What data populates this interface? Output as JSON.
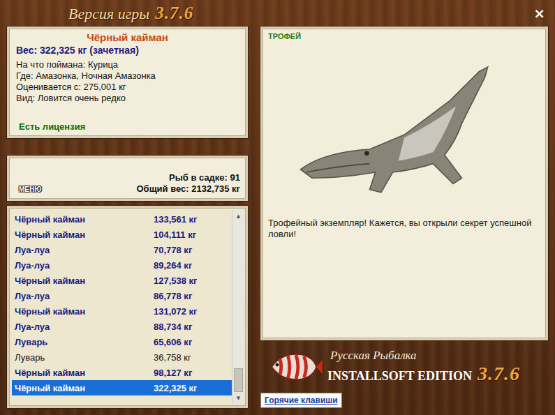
{
  "window": {
    "title": "Версия игры",
    "version": "3.7.6",
    "close": "×"
  },
  "catch": {
    "name": "Чёрный кайман",
    "weight": "Вес: 322,325 кг (зачетная)",
    "details": [
      "На что поймана: Курица",
      "Где: Амазонка, Ночная Амазонка",
      "Оценивается с: 275,001 кг",
      "Вид: Ловится очень редко"
    ],
    "license": "Есть лицензия"
  },
  "keepnet": {
    "menu": "МЕНЮ",
    "count": "Рыб в садке: 91",
    "total": "Общий вес: 2132,735 кг"
  },
  "fish_list": [
    {
      "name": "Чёрный кайман",
      "weight": "133,561 кг",
      "counted": true,
      "selected": false
    },
    {
      "name": "Чёрный кайман",
      "weight": "104,111 кг",
      "counted": true,
      "selected": false
    },
    {
      "name": "Луа-луа",
      "weight": "70,778 кг",
      "counted": true,
      "selected": false
    },
    {
      "name": "Луа-луа",
      "weight": "89,264 кг",
      "counted": true,
      "selected": false
    },
    {
      "name": "Чёрный кайман",
      "weight": "127,538 кг",
      "counted": true,
      "selected": false
    },
    {
      "name": "Луа-луа",
      "weight": "86,778 кг",
      "counted": true,
      "selected": false
    },
    {
      "name": "Чёрный кайман",
      "weight": "131,072 кг",
      "counted": true,
      "selected": false
    },
    {
      "name": "Луа-луа",
      "weight": "88,734 кг",
      "counted": true,
      "selected": false
    },
    {
      "name": "Луварь",
      "weight": "65,606 кг",
      "counted": true,
      "selected": false
    },
    {
      "name": "Луварь",
      "weight": "36,758 кг",
      "counted": false,
      "selected": false
    },
    {
      "name": "Чёрный кайман",
      "weight": "98,127 кг",
      "counted": true,
      "selected": false
    },
    {
      "name": "Чёрный кайман",
      "weight": "322,325 кг",
      "counted": true,
      "selected": true
    }
  ],
  "scrollbar": {
    "up": "▲",
    "down": "▼",
    "level": 1
  },
  "trophy": {
    "badge": "ТРОФЕЙ",
    "message": "Трофейный экземпляр! Кажется, вы открыли секрет успешной ловли!"
  },
  "brand": {
    "name": "Русская Рыбалка",
    "edition": "INSTALLSOFT EDITION",
    "version": "3.7.6"
  },
  "hotkeys": "Горячие клавиши"
}
